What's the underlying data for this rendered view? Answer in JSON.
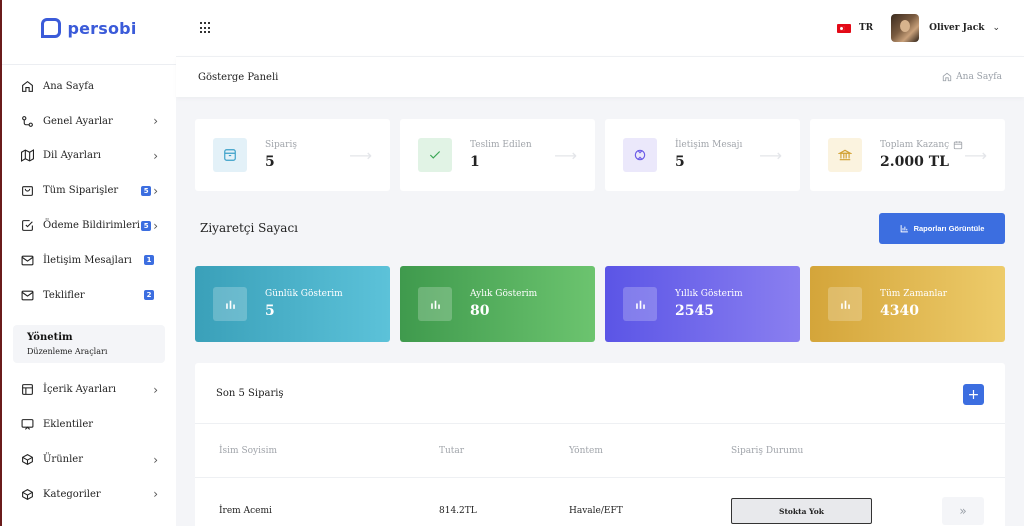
{
  "brand": {
    "name": "persobi"
  },
  "sidebar": {
    "items": [
      {
        "label": "Ana Sayfa",
        "icon": "home-icon",
        "chevron": false,
        "badge": ""
      },
      {
        "label": "Genel Ayarlar",
        "icon": "settings-icon",
        "chevron": true,
        "badge": ""
      },
      {
        "label": "Dil Ayarları",
        "icon": "map-icon",
        "chevron": true,
        "badge": ""
      },
      {
        "label": "Tüm Siparişler",
        "icon": "shopping-bag-icon",
        "chevron": true,
        "badge": "5"
      },
      {
        "label": "Ödeme Bildirimleri",
        "icon": "check-square-icon",
        "chevron": true,
        "badge": "5"
      },
      {
        "label": "İletişim Mesajları",
        "icon": "mail-icon",
        "chevron": false,
        "badge": "1"
      },
      {
        "label": "Teklifler",
        "icon": "mail-icon",
        "chevron": false,
        "badge": "2"
      }
    ],
    "section": {
      "title": "Yönetim",
      "subtitle": "Düzenleme Araçları"
    },
    "items2": [
      {
        "label": "İçerik Ayarları",
        "icon": "layout-icon",
        "chevron": true
      },
      {
        "label": "Eklentiler",
        "icon": "monitor-icon",
        "chevron": false
      },
      {
        "label": "Ürünler",
        "icon": "box-icon",
        "chevron": true
      },
      {
        "label": "Kategoriler",
        "icon": "box-icon",
        "chevron": true
      }
    ]
  },
  "topbar": {
    "language": "TR",
    "user_name": "Oliver Jack"
  },
  "breadcrumb": {
    "title": "Gösterge Paneli",
    "home": "Ana Sayfa"
  },
  "stats": [
    {
      "label": "Sipariş",
      "value": "5",
      "icon": "archive-icon",
      "color": "#e3f1f8"
    },
    {
      "label": "Teslim Edilen",
      "value": "1",
      "icon": "check-icon",
      "color": "#e1f3e5"
    },
    {
      "label": "İletişim Mesajı",
      "value": "5",
      "icon": "message-icon",
      "color": "#ebe8fb"
    },
    {
      "label": "Toplam Kazanç",
      "value": "2.000 TL",
      "icon": "bank-icon",
      "color": "#fbf3df"
    }
  ],
  "visitor": {
    "title": "Ziyaretçi Sayacı",
    "report_button": "Raporları Görüntüle",
    "cards": [
      {
        "label": "Günlük Gösterim",
        "value": "5"
      },
      {
        "label": "Aylık Gösterim",
        "value": "80"
      },
      {
        "label": "Yıllık Gösterim",
        "value": "2545"
      },
      {
        "label": "Tüm Zamanlar",
        "value": "4340"
      }
    ]
  },
  "orders": {
    "title": "Son 5 Sipariş",
    "columns": [
      "İsim Soyisim",
      "Tutar",
      "Yöntem",
      "Sipariş Durumu"
    ],
    "rows": [
      {
        "name": "İrem Acemi",
        "amount": "814.2TL",
        "method": "Havale/EFT",
        "status": "Stokta Yok"
      }
    ]
  }
}
